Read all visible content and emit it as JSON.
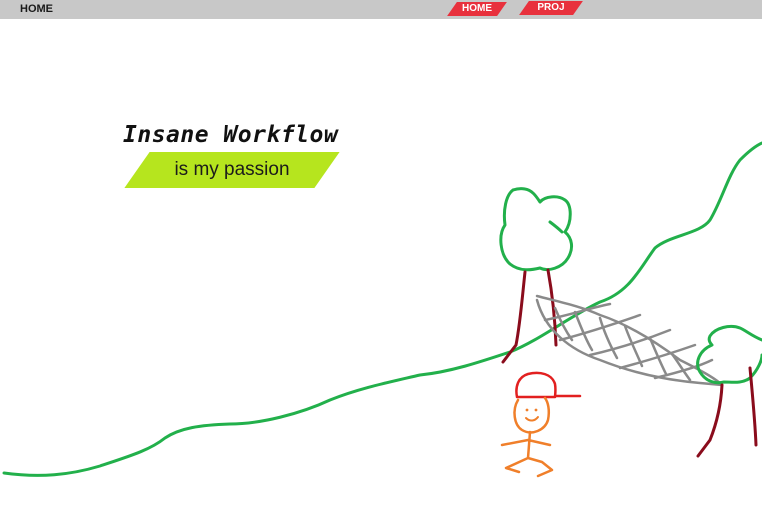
{
  "nav": {
    "home_left": "HOME",
    "tabs": [
      {
        "label": "HOME"
      },
      {
        "label": "PROJ"
      }
    ],
    "tab_color": "#e8313d",
    "bar_color": "#c8c8c8"
  },
  "hero": {
    "title": "Insane Workflow",
    "subtitle": "is my passion",
    "subtitle_color": "#b6e51e"
  },
  "doodle": {
    "hill_color": "#22b04b",
    "trunk_color": "#8a0c1c",
    "net_color": "#8a8a8a",
    "cap_color": "#e22020",
    "person_color": "#f07f2a"
  }
}
